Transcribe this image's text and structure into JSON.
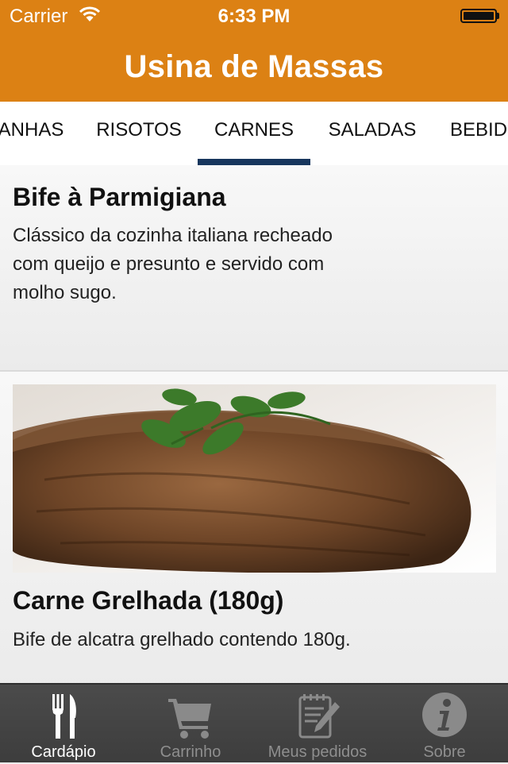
{
  "status_bar": {
    "carrier": "Carrier",
    "time": "6:33 PM"
  },
  "header": {
    "title": "Usina de Massas",
    "bg_color": "#dc8114"
  },
  "category_tabs": {
    "items": [
      {
        "label": "ANHAS"
      },
      {
        "label": "RISOTOS"
      },
      {
        "label": "CARNES",
        "selected": true
      },
      {
        "label": "SALADAS"
      },
      {
        "label": "BEBID"
      }
    ],
    "indicator_color": "#17365d"
  },
  "dishes": [
    {
      "name": "Bife à Parmigiana",
      "description": "Clássico da cozinha italiana recheado com queijo e presunto e servido com molho sugo."
    },
    {
      "name": "Carne Grelhada (180g)",
      "description": "Bife de alcatra grelhado contendo 180g.",
      "image": "grilled-steak-photo"
    }
  ],
  "tab_bar": {
    "items": [
      {
        "label": "Cardápio",
        "icon": "fork-knife-icon",
        "active": true
      },
      {
        "label": "Carrinho",
        "icon": "cart-icon"
      },
      {
        "label": "Meus pedidos",
        "icon": "notepad-pencil-icon"
      },
      {
        "label": "Sobre",
        "icon": "info-icon"
      }
    ]
  }
}
